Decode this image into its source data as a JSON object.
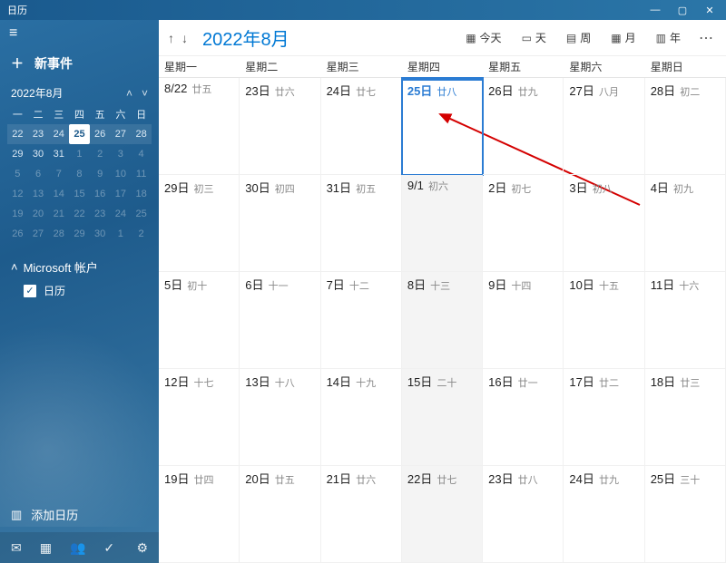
{
  "titlebar": {
    "app": "日历"
  },
  "sidebar": {
    "newEvent": "新事件",
    "miniMonth": "2022年8月",
    "dows": [
      "一",
      "二",
      "三",
      "四",
      "五",
      "六",
      "日"
    ],
    "miniGrid": [
      [
        {
          "n": "22"
        },
        {
          "n": "23"
        },
        {
          "n": "24"
        },
        {
          "n": "25",
          "hl": true
        },
        {
          "n": "26"
        },
        {
          "n": "27"
        },
        {
          "n": "28"
        }
      ],
      [
        {
          "n": "29"
        },
        {
          "n": "30"
        },
        {
          "n": "31"
        },
        {
          "n": "1",
          "dim": true
        },
        {
          "n": "2",
          "dim": true
        },
        {
          "n": "3",
          "dim": true
        },
        {
          "n": "4",
          "dim": true
        }
      ],
      [
        {
          "n": "5",
          "dim": true
        },
        {
          "n": "6",
          "dim": true
        },
        {
          "n": "7",
          "dim": true
        },
        {
          "n": "8",
          "dim": true
        },
        {
          "n": "9",
          "dim": true
        },
        {
          "n": "10",
          "dim": true
        },
        {
          "n": "11",
          "dim": true
        }
      ],
      [
        {
          "n": "12",
          "dim": true
        },
        {
          "n": "13",
          "dim": true
        },
        {
          "n": "14",
          "dim": true
        },
        {
          "n": "15",
          "dim": true
        },
        {
          "n": "16",
          "dim": true
        },
        {
          "n": "17",
          "dim": true
        },
        {
          "n": "18",
          "dim": true
        }
      ],
      [
        {
          "n": "19",
          "dim": true
        },
        {
          "n": "20",
          "dim": true
        },
        {
          "n": "21",
          "dim": true
        },
        {
          "n": "22",
          "dim": true
        },
        {
          "n": "23",
          "dim": true
        },
        {
          "n": "24",
          "dim": true
        },
        {
          "n": "25",
          "dim": true
        }
      ],
      [
        {
          "n": "26",
          "dim": true
        },
        {
          "n": "27",
          "dim": true
        },
        {
          "n": "28",
          "dim": true
        },
        {
          "n": "29",
          "dim": true
        },
        {
          "n": "30",
          "dim": true
        },
        {
          "n": "1",
          "dim": true
        },
        {
          "n": "2",
          "dim": true
        }
      ]
    ],
    "account": "Microsoft 帐户",
    "calLabel": "日历",
    "addCal": "添加日历"
  },
  "toolbar": {
    "title": "2022年8月",
    "today": "今天",
    "day": "天",
    "week": "周",
    "month": "月",
    "year": "年"
  },
  "dows": [
    "星期一",
    "星期二",
    "星期三",
    "星期四",
    "星期五",
    "星期六",
    "星期日"
  ],
  "grid": [
    [
      {
        "d": "8/22",
        "l": "廿五"
      },
      {
        "d": "23日",
        "l": "廿六"
      },
      {
        "d": "24日",
        "l": "廿七"
      },
      {
        "d": "25日",
        "l": "廿八",
        "today": true
      },
      {
        "d": "26日",
        "l": "廿九"
      },
      {
        "d": "27日",
        "l": "八月"
      },
      {
        "d": "28日",
        "l": "初二"
      }
    ],
    [
      {
        "d": "29日",
        "l": "初三"
      },
      {
        "d": "30日",
        "l": "初四"
      },
      {
        "d": "31日",
        "l": "初五"
      },
      {
        "d": "9/1",
        "l": "初六",
        "shade": true
      },
      {
        "d": "2日",
        "l": "初七"
      },
      {
        "d": "3日",
        "l": "初八"
      },
      {
        "d": "4日",
        "l": "初九"
      }
    ],
    [
      {
        "d": "5日",
        "l": "初十"
      },
      {
        "d": "6日",
        "l": "十一"
      },
      {
        "d": "7日",
        "l": "十二"
      },
      {
        "d": "8日",
        "l": "十三",
        "shade": true
      },
      {
        "d": "9日",
        "l": "十四"
      },
      {
        "d": "10日",
        "l": "十五"
      },
      {
        "d": "11日",
        "l": "十六"
      }
    ],
    [
      {
        "d": "12日",
        "l": "十七"
      },
      {
        "d": "13日",
        "l": "十八"
      },
      {
        "d": "14日",
        "l": "十九"
      },
      {
        "d": "15日",
        "l": "二十",
        "shade": true
      },
      {
        "d": "16日",
        "l": "廿一"
      },
      {
        "d": "17日",
        "l": "廿二"
      },
      {
        "d": "18日",
        "l": "廿三"
      }
    ],
    [
      {
        "d": "19日",
        "l": "廿四"
      },
      {
        "d": "20日",
        "l": "廿五"
      },
      {
        "d": "21日",
        "l": "廿六"
      },
      {
        "d": "22日",
        "l": "廿七",
        "shade": true
      },
      {
        "d": "23日",
        "l": "廿八"
      },
      {
        "d": "24日",
        "l": "廿九"
      },
      {
        "d": "25日",
        "l": "三十"
      }
    ]
  ]
}
